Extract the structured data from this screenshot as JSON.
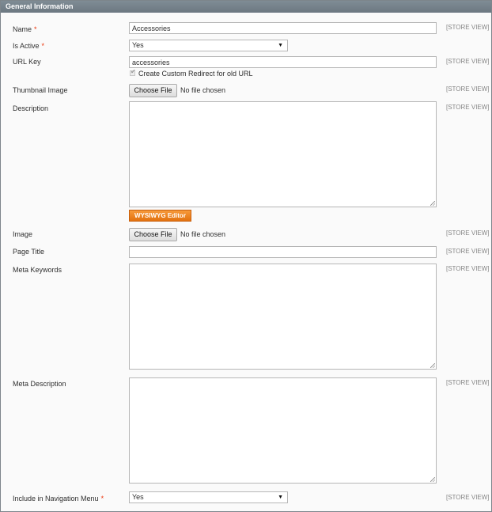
{
  "section": {
    "title": "General Information"
  },
  "scope_label": "[STORE VIEW]",
  "fields": {
    "name": {
      "label": "Name",
      "required": "*",
      "value": "Accessories"
    },
    "is_active": {
      "label": "Is Active",
      "required": "*",
      "value": "Yes"
    },
    "url_key": {
      "label": "URL Key",
      "value": "accessories",
      "redirect_label": "Create Custom Redirect for old URL",
      "redirect_checked": true
    },
    "thumbnail": {
      "label": "Thumbnail Image",
      "button": "Choose File",
      "status": "No file chosen"
    },
    "description": {
      "label": "Description",
      "value": "",
      "editor_button": "WYSIWYG Editor"
    },
    "image": {
      "label": "Image",
      "button": "Choose File",
      "status": "No file chosen"
    },
    "page_title": {
      "label": "Page Title",
      "value": ""
    },
    "meta_keywords": {
      "label": "Meta Keywords",
      "value": ""
    },
    "meta_description": {
      "label": "Meta Description",
      "value": ""
    },
    "nav_menu": {
      "label": "Include in Navigation Menu",
      "required": "*",
      "value": "Yes"
    }
  },
  "icons": {
    "select_arrow": "dropdown-arrow",
    "checkbox_mark": "checkmark",
    "resize": "resize-grip"
  },
  "colors": {
    "header_bg": "#72808a",
    "required": "#eb340a",
    "wysiwyg": "#ef8323",
    "scope_text": "#868686"
  }
}
